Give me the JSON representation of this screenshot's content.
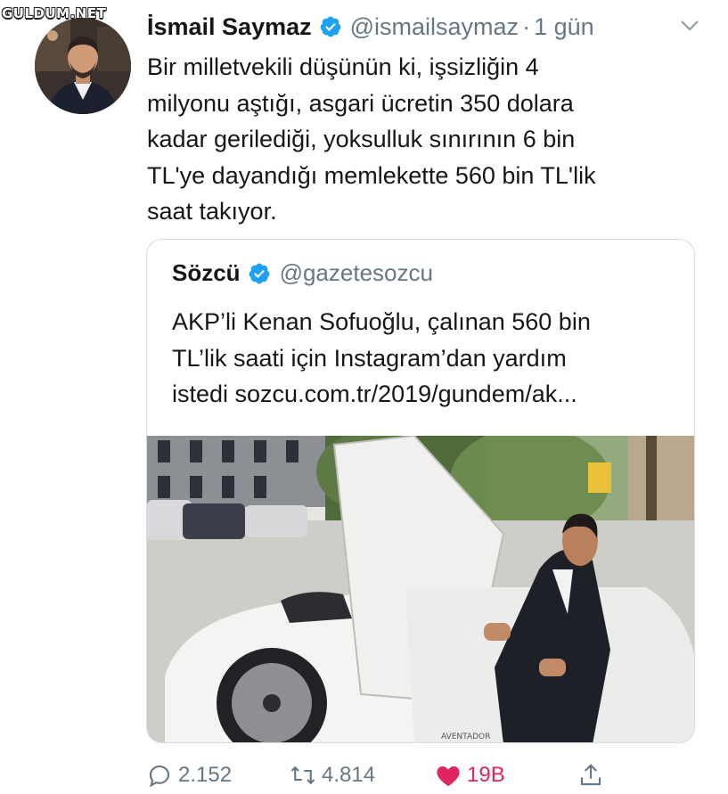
{
  "watermark": "GULDUM.NET",
  "tweet": {
    "author_name": "İsmail Saymaz",
    "author_handle": "@ismailsaymaz",
    "separator": "·",
    "time": "1 gün",
    "text_lines": [
      "Bir milletvekili düşünün ki, işsizliğin 4",
      "milyonu aştığı, asgari ücretin 350 dolara",
      "kadar gerilediği, yoksulluk sınırının 6 bin",
      "TL'ye dayandığı memlekette 560 bin TL'lik",
      "saat takıyor."
    ]
  },
  "quoted_tweet": {
    "author_name": "Sözcü",
    "author_handle": "@gazetesozcu",
    "text_lines": [
      "AKP’li Kenan Sofuoğlu, çalınan 560 bin",
      "TL’lik saati için Instagram’dan yardım",
      "istedi sozcu.com.tr/2019/gundem/ak..."
    ],
    "image_plate_text": "AVENTADOR"
  },
  "actions": {
    "replies": "2.152",
    "retweets": "4.814",
    "likes": "19B"
  },
  "colors": {
    "verified": "#1da1f2",
    "secondary_text": "#657786",
    "like": "#e0245e",
    "border": "#d4dbe1"
  },
  "icons": [
    "verified-badge-icon",
    "chevron-down-icon",
    "reply-icon",
    "retweet-icon",
    "heart-icon",
    "share-icon"
  ]
}
